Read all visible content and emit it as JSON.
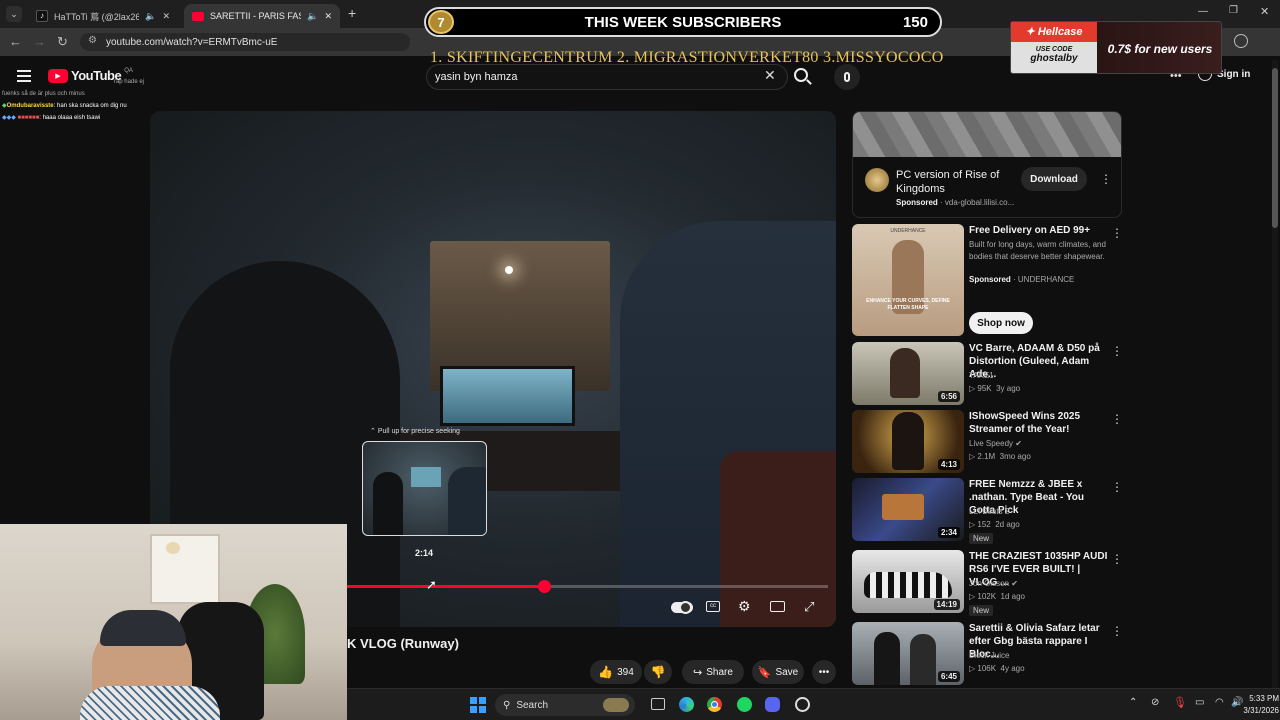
{
  "browser": {
    "tabs": [
      {
        "label": "HaTToTi 蔦 (@2lax26_) is LIVE",
        "active": false
      },
      {
        "label": "SARETTII - PARIS FASHION",
        "active": true
      }
    ],
    "new_tab": "+",
    "url": "youtube.com/watch?v=ERMTvBmc-uE"
  },
  "youtube": {
    "logo": "YouTube",
    "region": "QA",
    "search_value": "yasin byn hamza",
    "sign_in": "Sign in"
  },
  "overlay": {
    "banner_title": "THIS WEEK SUBSCRIBERS",
    "banner_number": "7",
    "banner_count": "150",
    "ticker": "1. SKIFTINGECENTRUM  2. MIGRASTIONVERKET80 3.MISSYOCOCO",
    "hellcase_brand": "Hellcase",
    "hellcase_use": "USE CODE",
    "hellcase_code": "ghostalby",
    "hellcase_offer": "0.7$ for new users"
  },
  "chat": [
    {
      "user": "",
      "msg": "rap hade ej"
    },
    {
      "user": "",
      "msg": "fuenks så de är plus och minus"
    },
    {
      "user": "Omdubaravisste",
      "msg": ": han ska snacka om dig nu"
    },
    {
      "user": "",
      "msg": ": haaa olaaa eish tsawi"
    }
  ],
  "player": {
    "pull_hint": "Pull up for precise seeking",
    "preview_time": "2:14",
    "progress_fraction": 0.41,
    "title_fragment": "K VLOG (Runway)"
  },
  "actions": {
    "likes": "394",
    "share": "Share",
    "save": "Save"
  },
  "sidebar": {
    "ad": {
      "title": "PC version of Rise of Kingdoms",
      "sponsored": "Sponsored",
      "domain": "· vda-global.lilisi.co...",
      "button": "Download"
    },
    "promo": {
      "title": "Free Delivery on AED 99+",
      "desc": "Built for long days, warm climates, and bodies that deserve better shapewear.",
      "sponsored": "Sponsored",
      "brand": "· UNDERHANCE",
      "button": "Shop now",
      "thumb_brand": "UNDERHANCE",
      "thumb_tag": "ENHANCE YOUR CURVES, DEFINE FLATTEN SHAPE"
    },
    "videos": [
      {
        "title": "VC Barre, ADAAM & D50 på Distortion (Guleed, Adam Ade...",
        "channel": "TAKE1",
        "verified": false,
        "views": "95K",
        "age": "3y ago",
        "duration": "6:56",
        "is_new": false
      },
      {
        "title": "IShowSpeed Wins 2025 Streamer of the Year!",
        "channel": "Live Speedy",
        "verified": true,
        "views": "2.1M",
        "age": "3mo ago",
        "duration": "4:13",
        "is_new": false
      },
      {
        "title": "FREE Nemzzz & JBEE x .nathan. Type Beat - You Gotta Pick",
        "channel": "LLTBeats 2",
        "verified": false,
        "views": "152",
        "age": "2d ago",
        "duration": "2:34",
        "is_new": true
      },
      {
        "title": "THE CRAZIEST 1035HP AUDI RS6 I'VE EVER BUILT! | VLOG ...",
        "channel": "Jon Olsson",
        "verified": true,
        "views": "102K",
        "age": "1d ago",
        "duration": "14:19",
        "is_new": true
      },
      {
        "title": "Sarettii & Olivia Safarz letar efter Gbg bästa rappare I Bloc...",
        "channel": "Block Juice",
        "verified": false,
        "views": "106K",
        "age": "4y ago",
        "duration": "6:45",
        "is_new": false
      }
    ],
    "new_label": "New",
    "views_suffix": "views"
  },
  "taskbar": {
    "search": "Search",
    "time": "5:33 PM",
    "date": "3/31/2026"
  },
  "colors": {
    "yt_red": "#ff0033",
    "gold": "#e8c45a",
    "hellcase_red": "#e23b2e"
  }
}
